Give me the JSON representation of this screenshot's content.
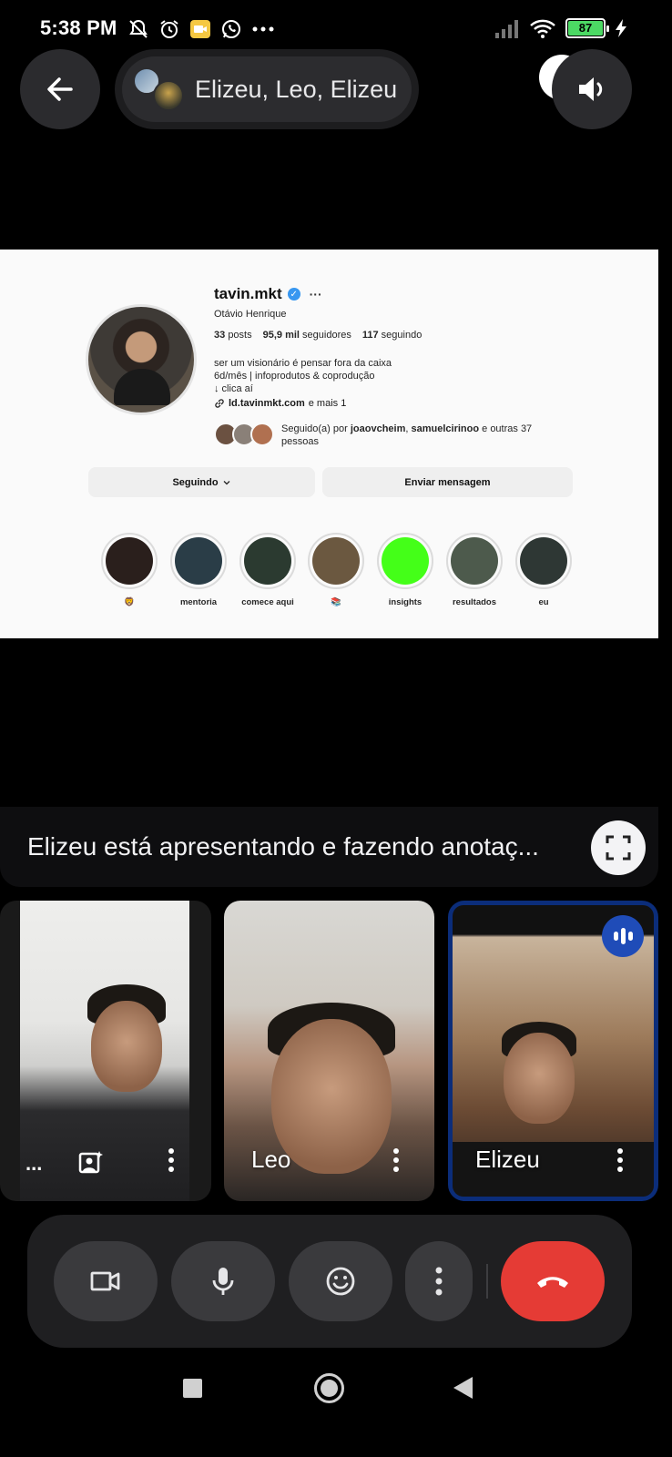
{
  "status_bar": {
    "time": "5:38 PM",
    "battery": "87",
    "icons_left": [
      "bell-off-icon",
      "alarm-icon",
      "video-app-icon",
      "whatsapp-icon",
      "more-dots-icon"
    ],
    "icons_right": [
      "signal-icon",
      "wifi-icon",
      "battery-icon",
      "charging-icon"
    ]
  },
  "header": {
    "title": "Elizeu, Leo, Elizeu"
  },
  "shared_screen": {
    "username": "tavin.mkt",
    "full_name": "Otávio Henrique",
    "posts_count": "33",
    "posts_label": "posts",
    "followers_count": "95,9 mil",
    "followers_label": "seguidores",
    "following_count": "117",
    "following_label": "seguindo",
    "bio": [
      "ser um visionário é pensar fora da caixa",
      "6d/mês | infoprodutos & coprodução",
      "↓ clica aí"
    ],
    "link": "ld.tavinmkt.com",
    "link_more": "e mais 1",
    "followed_by_prefix": "Seguido(a) por",
    "followed_by_user1": "joaovcheim",
    "followed_by_sep": ",",
    "followed_by_user2": "samuelcirinoo",
    "followed_by_suffix": "e outras 37 pessoas",
    "following_button": "Seguindo",
    "message_button": "Enviar mensagem",
    "highlights": [
      {
        "label": "🦁",
        "color": "#2a1f1c"
      },
      {
        "label": "mentoria",
        "color": "#2a3d47"
      },
      {
        "label": "comece aqui",
        "color": "#2b3a30"
      },
      {
        "label": "📚",
        "color": "#6b5840"
      },
      {
        "label": "insights",
        "color": "#44ff18"
      },
      {
        "label": "resultados",
        "color": "#4d5a4c"
      },
      {
        "label": "eu",
        "color": "#2e3734"
      }
    ]
  },
  "presenting": {
    "text": "Elizeu está apresentando e fazendo anotaç..."
  },
  "participants": [
    {
      "name": "",
      "self_view": true
    },
    {
      "name": "Leo"
    },
    {
      "name": "Elizeu",
      "speaking": true
    }
  ],
  "self_tile_more": "...",
  "controls": {
    "accent_end_call": "#e53b35",
    "speaking_badge_color": "#1f4cb8"
  }
}
